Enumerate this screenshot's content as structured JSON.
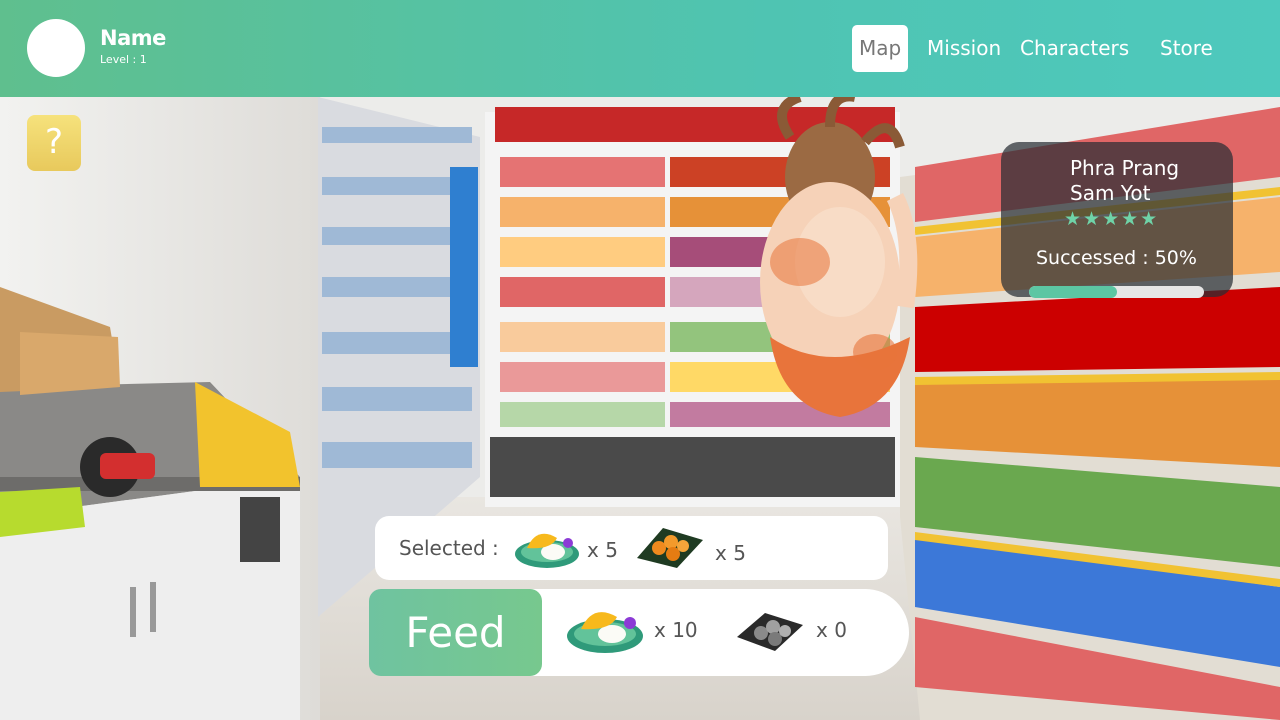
{
  "header": {
    "player_name": "Name",
    "player_level": "Level : 1",
    "nav": [
      {
        "label": "Map",
        "active": true
      },
      {
        "label": "Mission",
        "active": false
      },
      {
        "label": "Characters",
        "active": false
      },
      {
        "label": "Store",
        "active": false
      }
    ]
  },
  "help_button": {
    "label": "?"
  },
  "character_card": {
    "name_line1": "Phra Prang",
    "name_line2": "Sam Yot",
    "stars": "★★★★★",
    "success_text": "Successed : 50%",
    "progress": 0.5
  },
  "selection": {
    "label": "Selected :",
    "items": [
      {
        "icon": "mango-sticky-rice-icon",
        "count": "x 5"
      },
      {
        "icon": "fried-dessert-icon",
        "count": "x 5"
      }
    ]
  },
  "feed": {
    "button_label": "Feed",
    "inventory": [
      {
        "icon": "mango-sticky-rice-icon",
        "count": "x 10"
      },
      {
        "icon": "locked-dessert-icon",
        "count": "x 0"
      }
    ]
  },
  "colors": {
    "header_start": "#5fbf8e",
    "header_end": "#4ec9bd",
    "accent_green": "#5cc6a3",
    "help_yellow": "#f0d66a"
  }
}
